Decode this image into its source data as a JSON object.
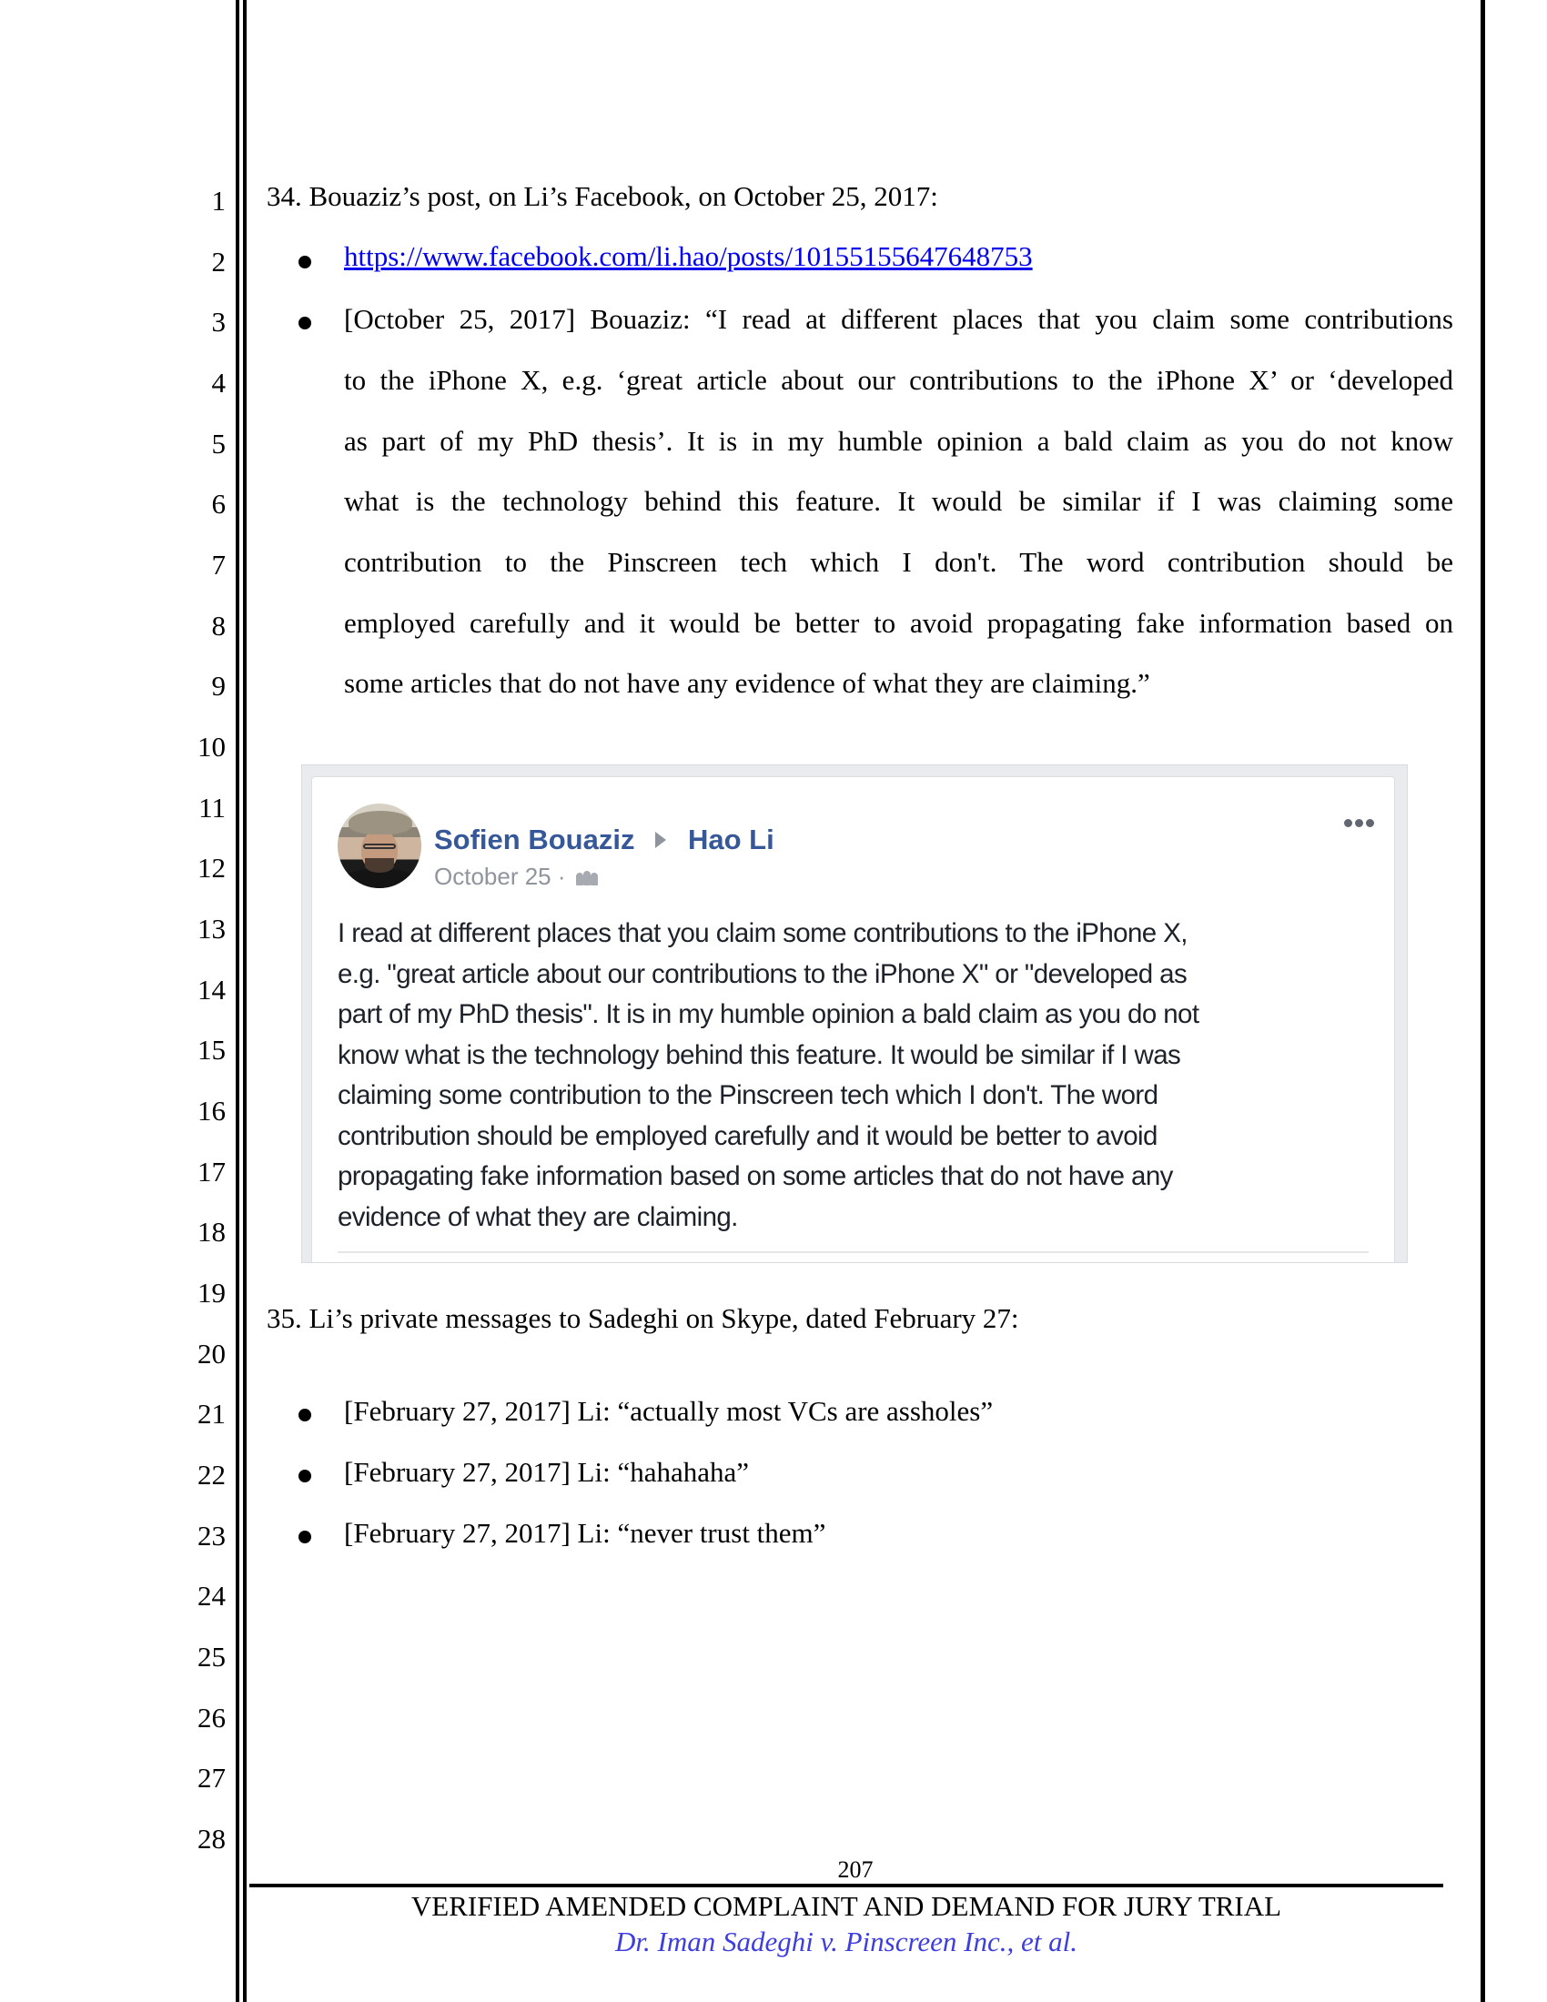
{
  "line_numbers": [
    "1",
    "2",
    "3",
    "4",
    "5",
    "6",
    "7",
    "8",
    "9",
    "10",
    "11",
    "12",
    "13",
    "14",
    "15",
    "16",
    "17",
    "18",
    "19",
    "20",
    "21",
    "22",
    "23",
    "24",
    "25",
    "26",
    "27",
    "28"
  ],
  "section_34": {
    "heading": "34. Bouaziz’s post, on Li’s Facebook, on October 25, 2017:",
    "link": "https://www.facebook.com/li.hao/posts/10155155647648753",
    "quote_lines": [
      "[October 25, 2017] Bouaziz: “I read at different places that you claim some contributions",
      "to the iPhone X, e.g. ‘great article about our contributions to the iPhone X’ or ‘developed",
      "as part of my PhD thesis’. It is in my humble opinion a bald claim as you do not know",
      "what is the technology behind this feature. It would be similar if I was claiming some",
      "contribution to the Pinscreen tech which I don't. The word contribution should be",
      "employed carefully and it would be better to avoid propagating fake information based on",
      "some articles that do not have any evidence of what they are claiming.”"
    ]
  },
  "facebook_post": {
    "author": "Sofien Bouaziz",
    "target": "Hao Li",
    "date": "October 25",
    "separator": "·",
    "audience_icon": "friends-icon",
    "more_icon": "more-options-icon",
    "body_lines": [
      "I read at different places that you claim some contributions to the iPhone X,",
      "e.g. \"great article about our contributions to the iPhone X\" or \"developed as",
      "part of my PhD thesis\". It is in my humble opinion a bald claim as you do not",
      "know what is the technology behind this feature. It would be similar if I was",
      "claiming some contribution to the Pinscreen tech which I don't. The word",
      "contribution should be employed carefully and it would be better to avoid",
      "propagating fake information based on some articles that do not have any",
      "evidence of what they are claiming."
    ],
    "colors": {
      "name": "#365899",
      "meta": "#90949c",
      "text": "#1d2129",
      "frame": "#e9ebee"
    }
  },
  "section_35": {
    "heading": "35. Li’s private messages to Sadeghi on Skype, dated February 27:",
    "bullets": [
      "[February 27, 2017] Li: “actually most VCs are assholes”",
      "[February 27, 2017] Li: “hahahaha”",
      "[February 27, 2017] Li: “never trust them”"
    ]
  },
  "footer": {
    "page_number": "207",
    "title": "VERIFIED AMENDED COMPLAINT AND DEMAND FOR JURY TRIAL",
    "caption": "Dr. Iman Sadeghi v. Pinscreen Inc., et al.",
    "caption_color": "#3e3ee0"
  }
}
